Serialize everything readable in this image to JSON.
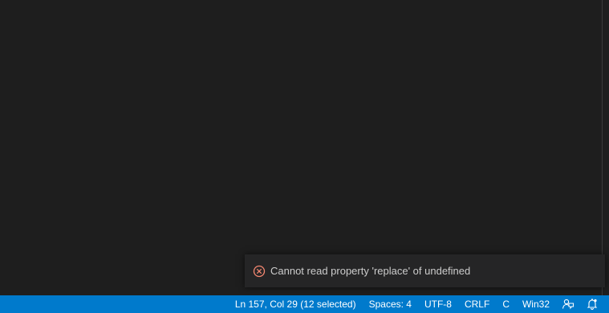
{
  "notification": {
    "message": "Cannot read property 'replace' of undefined",
    "icon": "error-circle-icon",
    "icon_color": "#f48771"
  },
  "statusbar": {
    "background": "#007acc",
    "cursor_position": "Ln 157, Col 29 (12 selected)",
    "indentation": "Spaces: 4",
    "encoding": "UTF-8",
    "line_ending": "CRLF",
    "language": "C",
    "configuration": "Win32",
    "feedback_icon": "feedback-icon",
    "notifications_icon": "bell-icon"
  }
}
